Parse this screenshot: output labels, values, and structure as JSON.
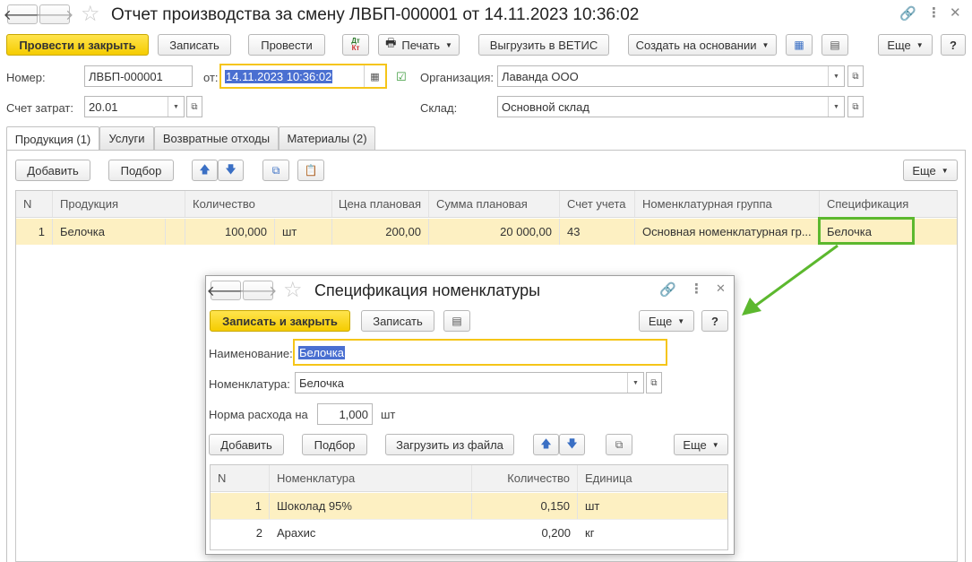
{
  "main": {
    "title": "Отчет производства за смену ЛВБП-000001 от 14.11.2023 10:36:02",
    "toolbar": {
      "post_close": "Провести и закрыть",
      "save": "Записать",
      "post": "Провести",
      "dtkt_top": "Дт",
      "dtkt_bottom": "Кт",
      "print": "Печать",
      "vetis": "Выгрузить в ВЕТИС",
      "create_based": "Создать на основании",
      "more": "Еще",
      "help": "?"
    },
    "fields": {
      "number_label": "Номер:",
      "number_value": "ЛВБП-000001",
      "from_label": "от:",
      "date_value": "14.11.2023 10:36:02",
      "org_label": "Организация:",
      "org_value": "Лаванда ООО",
      "account_label": "Счет затрат:",
      "account_value": "20.01",
      "warehouse_label": "Склад:",
      "warehouse_value": "Основной склад"
    },
    "tabs": [
      {
        "label": "Продукция (1)"
      },
      {
        "label": "Услуги"
      },
      {
        "label": "Возвратные отходы"
      },
      {
        "label": "Материалы (2)"
      }
    ],
    "table_toolbar": {
      "add": "Добавить",
      "pick": "Подбор",
      "more": "Еще"
    },
    "table": {
      "columns": [
        "N",
        "Продукция",
        "Количество",
        "Цена плановая",
        "Сумма плановая",
        "Счет учета",
        "Номенклатурная группа",
        "Спецификация"
      ],
      "rows": [
        {
          "n": "1",
          "product": "Белочка",
          "qty": "100,000",
          "unit": "шт",
          "price": "200,00",
          "sum": "20 000,00",
          "account": "43",
          "group": "Основная номенклатурная гр...",
          "spec": "Белочка"
        }
      ]
    }
  },
  "dialog": {
    "title": "Спецификация номенклатуры",
    "toolbar": {
      "save_close": "Записать и закрыть",
      "save": "Записать",
      "more": "Еще",
      "help": "?"
    },
    "fields": {
      "name_label": "Наименование:",
      "name_value": "Белочка",
      "item_label": "Номенклатура:",
      "item_value": "Белочка",
      "norm_label": "Норма расхода на",
      "norm_value": "1,000",
      "norm_unit": "шт"
    },
    "table_toolbar": {
      "add": "Добавить",
      "pick": "Подбор",
      "load": "Загрузить из файла",
      "more": "Еще"
    },
    "table": {
      "columns": [
        "N",
        "Номенклатура",
        "Количество",
        "Единица"
      ],
      "rows": [
        {
          "n": "1",
          "item": "Шоколад 95%",
          "qty": "0,150",
          "unit": "шт"
        },
        {
          "n": "2",
          "item": "Арахис",
          "qty": "0,200",
          "unit": "кг"
        }
      ]
    }
  },
  "colors": {
    "primary_button": "#f5cc00",
    "highlight_border": "#5cb82e",
    "selected_row": "#fdf0c2",
    "focus_border": "#f5c518"
  }
}
